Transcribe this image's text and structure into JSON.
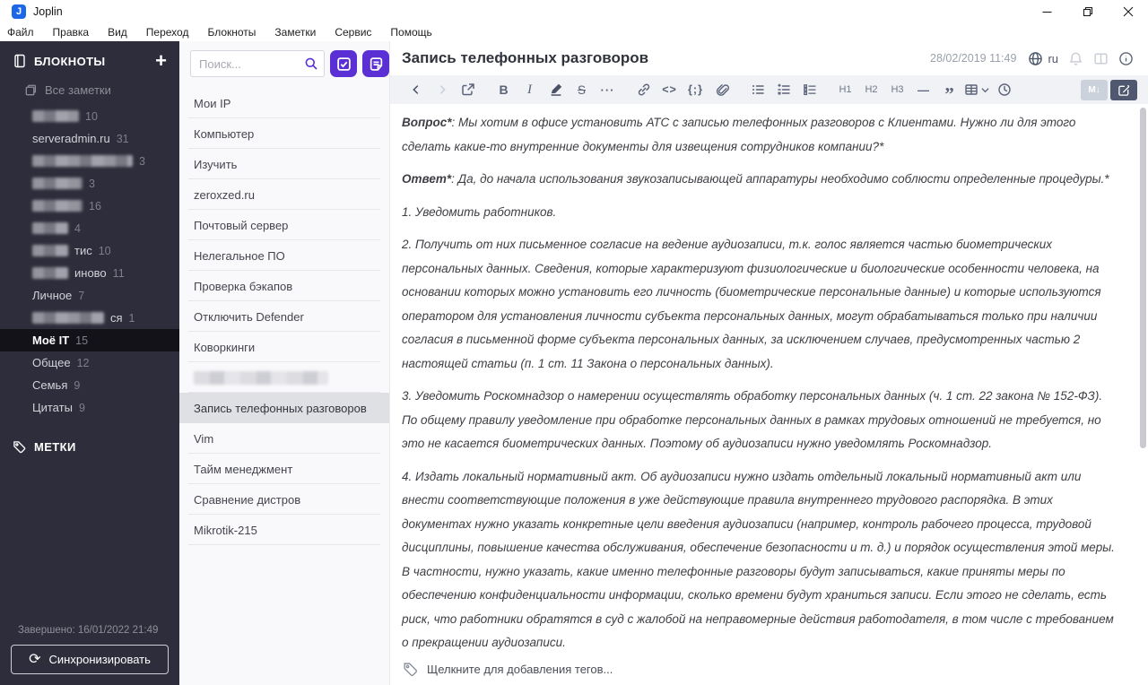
{
  "window": {
    "app_title": "Joplin"
  },
  "menu": {
    "items": [
      "Файл",
      "Правка",
      "Вид",
      "Переход",
      "Блокноты",
      "Заметки",
      "Сервис",
      "Помощь"
    ]
  },
  "sidebar": {
    "notebooks_header": "БЛОКНОТЫ",
    "add_notebook": "+",
    "all_notes": "Все заметки",
    "notebooks": [
      {
        "label": "",
        "redacted_width": 52,
        "count": "10"
      },
      {
        "label": "serveradmin.ru",
        "redacted_width": 0,
        "count": "31"
      },
      {
        "label": "",
        "redacted_width": 112,
        "count": "3"
      },
      {
        "label": "",
        "redacted_width": 56,
        "count": "3"
      },
      {
        "label": "",
        "redacted_width": 56,
        "count": "16"
      },
      {
        "label": "",
        "redacted_width": 40,
        "count": "4"
      },
      {
        "label": "тис",
        "redacted_width": 40,
        "count": "10"
      },
      {
        "label": "иново",
        "redacted_width": 40,
        "count": "11"
      },
      {
        "label": "Личное",
        "redacted_width": 0,
        "count": "7"
      },
      {
        "label": "ся",
        "redacted_width": 80,
        "count": "1"
      },
      {
        "label": "Моё IT",
        "redacted_width": 0,
        "count": "15",
        "selected": true
      },
      {
        "label": "Общее",
        "redacted_width": 0,
        "count": "12"
      },
      {
        "label": "Семья",
        "redacted_width": 0,
        "count": "9"
      },
      {
        "label": "Цитаты",
        "redacted_width": 0,
        "count": "9"
      }
    ],
    "tags_header": "МЕТКИ",
    "sync_status": "Завершено: 16/01/2022 21:49",
    "sync_icon": "⟳",
    "sync_button": "Синхронизировать"
  },
  "notelist": {
    "search_placeholder": "Поиск...",
    "notes": [
      {
        "label": "Мои IP"
      },
      {
        "label": "Компьютер"
      },
      {
        "label": "Изучить"
      },
      {
        "label": "zeroxzed.ru"
      },
      {
        "label": "Почтовый сервер"
      },
      {
        "label": "Нелегальное ПО"
      },
      {
        "label": "Проверка бэкапов"
      },
      {
        "label": "Отключить Defender"
      },
      {
        "label": "Коворкинги"
      },
      {
        "label": "",
        "redacted_width": 150
      },
      {
        "label": "Запись телефонных разговоров",
        "selected": true
      },
      {
        "label": "Vim"
      },
      {
        "label": "Тайм менеджмент"
      },
      {
        "label": "Сравнение дистров"
      },
      {
        "label": "Mikrotik-215"
      }
    ]
  },
  "editor": {
    "note_title": "Запись телефонных разговоров",
    "date": "28/02/2019 11:49",
    "locale": "ru",
    "toolbar": {
      "bold": "B",
      "italic": "I",
      "strike": "S",
      "more": "···",
      "inline_code": "<>",
      "code_block": "{;}",
      "h1": "H1",
      "h2": "H2",
      "h3": "H3",
      "hr": "—",
      "quote": "”",
      "markdown_badge": "M↓"
    },
    "paragraphs": [
      {
        "lead": "Вопрос*",
        "text": ": Мы хотим в офисе установить АТС с записью телефонных разговоров с Клиентами. Нужно ли для этого сделать какие-то внутренние документы для извещения сотрудников компании?*"
      },
      {
        "lead": "Ответ*",
        "text": ": Да, до начала использования звукозаписывающей аппаратуры необходимо соблюсти определенные процедуры.*"
      },
      {
        "lead": "",
        "text": "1. Уведомить работников."
      },
      {
        "lead": "",
        "text": "2. Получить от них письменное согласие на ведение аудиозаписи, т.к. голос является частью биометрических персональных данных. Сведения, которые характеризуют физиологические и биологические особенности человека, на основании которых можно установить его личность (биометрические персональные данные) и которые используются оператором для установления личности субъекта персональных данных, могут обрабатываться только при наличии согласия в письменной форме субъекта персональных данных, за исключением случаев, предусмотренных частью 2 настоящей статьи (п. 1 ст. 11 Закона о персональных данных)."
      },
      {
        "lead": "",
        "text": "3. Уведомить Роскомнадзор о намерении осуществлять обработку персональных данных (ч. 1 ст. 22 закона № 152-ФЗ). По общему правилу уведомление при обработке персональных данных в рамках трудовых отношений не требуется, но это не касается биометрических данных. Поэтому об аудиозаписи нужно уведомлять Роскомнадзор."
      },
      {
        "lead": "",
        "text": "4. Издать локальный нормативный акт. Об аудиозаписи нужно издать отдельный локальный нормативный акт или внести соответствующие положения в уже действующие правила внутреннего трудового распорядка. В этих документах нужно указать конкретные цели введения аудиозаписи (например, контроль рабочего процесса, трудовой дисциплины, повышение качества обслуживания, обеспечение безопасности и т. д.) и порядок осуществления этой меры. В частности, нужно указать, какие именно телефонные разговоры будут записываться, какие приняты меры по обеспечению конфиденциальности информации, сколько времени будут храниться записи. Если этого не сделать, есть риск, что работники обратятся в суд с жалобой на неправомерные действия работодателя, в том числе с требованием о прекращении аудиозаписи."
      }
    ],
    "tag_bar": "Щелкните для добавления тегов..."
  },
  "colors": {
    "accent_purple": "#5a2fd4",
    "sidebar_bg": "#2e2d3b",
    "sidebar_selected_bg": "#141219",
    "note_selected_bg": "#dfe0e4",
    "toolbar_bg": "#f1f2f6",
    "logo_blue": "#1b67e8",
    "editor_toggle_active": "#4f586e"
  }
}
